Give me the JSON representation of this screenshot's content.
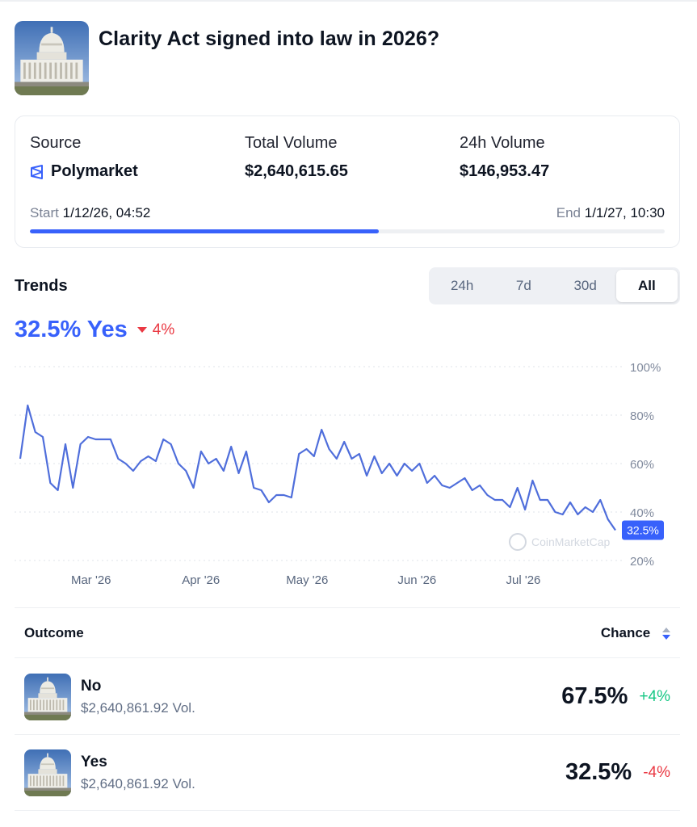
{
  "market": {
    "title": "Clarity Act signed into law in 2026?",
    "image_icon": "capitol-building-icon"
  },
  "stats": {
    "source_label": "Source",
    "source_value": "Polymarket",
    "source_icon": "polymarket-icon",
    "total_volume_label": "Total Volume",
    "total_volume_value": "$2,640,615.65",
    "volume_24h_label": "24h Volume",
    "volume_24h_value": "$146,953.47",
    "start_label": "Start",
    "start_value": "1/12/26, 04:52",
    "end_label": "End",
    "end_value": "1/1/27, 10:30",
    "progress": 0.55
  },
  "trends": {
    "title": "Trends",
    "tabs": [
      {
        "label": "24h",
        "active": false
      },
      {
        "label": "7d",
        "active": false
      },
      {
        "label": "30d",
        "active": false
      },
      {
        "label": "All",
        "active": true
      }
    ],
    "current_value": "32.5% Yes",
    "change": "4%",
    "change_direction": "down",
    "current_badge": "32.5%",
    "watermark": "CoinMarketCap"
  },
  "chart_data": {
    "type": "line",
    "x": [
      "2026-02-09",
      "2026-02-11",
      "2026-02-12",
      "2026-02-13",
      "2026-02-15",
      "2026-02-16",
      "2026-02-17",
      "2026-02-18",
      "2026-02-20",
      "2026-02-21",
      "2026-02-22",
      "2026-02-23",
      "2026-02-24",
      "2026-02-25",
      "2026-02-27",
      "2026-02-28",
      "2026-03-01",
      "2026-03-03",
      "2026-03-04",
      "2026-03-06",
      "2026-03-07",
      "2026-03-09",
      "2026-03-10",
      "2026-03-11",
      "2026-03-13",
      "2026-03-15",
      "2026-03-17",
      "2026-03-19",
      "2026-03-21",
      "2026-03-23",
      "2026-03-25",
      "2026-03-26",
      "2026-03-28",
      "2026-03-30",
      "2026-04-01",
      "2026-04-02",
      "2026-04-04",
      "2026-04-06",
      "2026-04-08",
      "2026-04-10",
      "2026-04-12",
      "2026-04-14",
      "2026-04-16",
      "2026-04-18",
      "2026-04-20",
      "2026-04-22",
      "2026-04-24",
      "2026-04-26",
      "2026-04-28",
      "2026-04-30",
      "2026-05-02",
      "2026-05-03",
      "2026-05-05",
      "2026-05-07",
      "2026-05-09",
      "2026-05-11",
      "2026-05-13",
      "2026-05-15",
      "2026-05-17",
      "2026-05-19",
      "2026-05-21",
      "2026-05-23",
      "2026-05-25",
      "2026-05-27",
      "2026-05-29",
      "2026-05-31",
      "2026-06-02",
      "2026-06-04",
      "2026-06-06",
      "2026-06-08",
      "2026-06-10",
      "2026-06-12",
      "2026-06-14",
      "2026-06-16",
      "2026-06-18",
      "2026-06-20",
      "2026-06-22",
      "2026-06-24",
      "2026-06-26",
      "2026-06-28",
      "2026-06-30",
      "2026-07-02",
      "2026-07-04",
      "2026-07-06",
      "2026-07-08",
      "2026-07-10",
      "2026-07-12",
      "2026-07-14",
      "2026-07-16",
      "2026-07-18",
      "2026-07-20",
      "2026-07-22",
      "2026-07-24",
      "2026-07-26",
      "2026-07-27"
    ],
    "series": [
      {
        "values": [
          62,
          84,
          73,
          71,
          52,
          49,
          68,
          50,
          68,
          71,
          70,
          70,
          70,
          62,
          60,
          57,
          61,
          63,
          61,
          70,
          68,
          60,
          57,
          50,
          65,
          60,
          62,
          57,
          67,
          56,
          65,
          50,
          49,
          44,
          47,
          47,
          46,
          64,
          66,
          63,
          74,
          66,
          62,
          69,
          62,
          64,
          55,
          63,
          56,
          60,
          55,
          60,
          57,
          60,
          52,
          55,
          51,
          50,
          52,
          54,
          49,
          51,
          47,
          45,
          45,
          42,
          50,
          41,
          53,
          45,
          45,
          40,
          39,
          44,
          39,
          42,
          40,
          45,
          37,
          32.5
        ],
        "color": "#4f6edb"
      }
    ],
    "ylim": [
      20,
      100
    ],
    "yticks": [
      "100%",
      "80%",
      "60%",
      "40%",
      "20%"
    ],
    "ytick_values": [
      100,
      80,
      60,
      40,
      20
    ],
    "xticks": [
      "Mar '26",
      "Apr '26",
      "May '26",
      "Jun '26",
      "Jul '26"
    ],
    "xtick_dates": [
      "2026-03-01",
      "2026-04-01",
      "2026-05-01",
      "2026-06-01",
      "2026-07-01"
    ],
    "grid": true,
    "last_value_label": "32.5%"
  },
  "outcomes": {
    "header_outcome": "Outcome",
    "header_chance": "Chance",
    "rows": [
      {
        "name": "No",
        "volume": "$2,640,861.92 Vol.",
        "chance": "67.5%",
        "change": "+4%",
        "change_color": "#16c784"
      },
      {
        "name": "Yes",
        "volume": "$2,640,861.92 Vol.",
        "chance": "32.5%",
        "change": "-4%",
        "change_color": "#ea3943"
      }
    ]
  },
  "colors": {
    "accent": "#3861fb",
    "line": "#4f6edb",
    "up": "#16c784",
    "down": "#ea3943"
  }
}
